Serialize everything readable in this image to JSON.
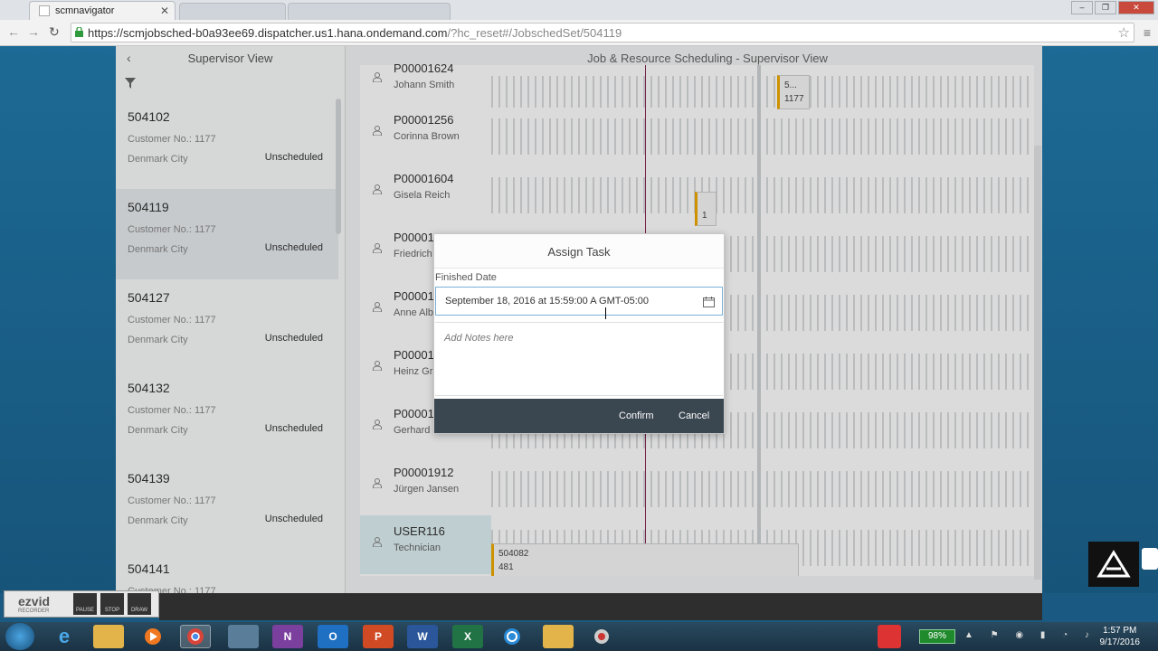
{
  "browser": {
    "tab_title": "scmnavigator",
    "url_host": "https://scmjobsched-b0a93ee69.dispatcher.us1.hana.ondemand.com",
    "url_path": "/?hc_reset#/JobschedSet/504119"
  },
  "master": {
    "title": "Supervisor View",
    "items": [
      {
        "id": "504102",
        "customer": "Customer No.: 1177",
        "city": "Denmark City",
        "status": "Unscheduled"
      },
      {
        "id": "504119",
        "customer": "Customer No.: 1177",
        "city": "Denmark City",
        "status": "Unscheduled"
      },
      {
        "id": "504127",
        "customer": "Customer No.: 1177",
        "city": "Denmark City",
        "status": "Unscheduled"
      },
      {
        "id": "504132",
        "customer": "Customer No.: 1177",
        "city": "Denmark City",
        "status": "Unscheduled"
      },
      {
        "id": "504139",
        "customer": "Customer No.: 1177",
        "city": "Denmark City",
        "status": "Unscheduled"
      },
      {
        "id": "504141",
        "customer": "Customer No.: 1177",
        "city": "",
        "status": ""
      }
    ]
  },
  "detail": {
    "title": "Job & Resource Scheduling - Supervisor View",
    "resources": [
      {
        "id": "P00001624",
        "name": "Johann Smith"
      },
      {
        "id": "P00001256",
        "name": "Corinna Brown"
      },
      {
        "id": "P00001604",
        "name": "Gisela Reich"
      },
      {
        "id": "P00001",
        "name": "Friedrich"
      },
      {
        "id": "P00001",
        "name": "Anne Alb"
      },
      {
        "id": "P00001",
        "name": "Heinz Gr"
      },
      {
        "id": "P00001",
        "name": "Gerhard Keller"
      },
      {
        "id": "P00001912",
        "name": "Jürgen Jansen"
      },
      {
        "id": "USER116",
        "name": "Technician"
      }
    ],
    "tasks": {
      "t1_line1": "5...",
      "t1_line2": "1177",
      "t2_line1": "1",
      "t3_line1": "504082",
      "t3_line2": "481"
    }
  },
  "dialog": {
    "title": "Assign Task",
    "finished_date_label": "Finished Date",
    "finished_date_value": "September 18, 2016 at 15:59:00 A GMT-05:00",
    "notes_placeholder": "Add Notes here",
    "confirm_label": "Confirm",
    "cancel_label": "Cancel"
  },
  "ezvid": {
    "logo": "ezvid",
    "sub": "RECORDER",
    "pause": "PAUSE",
    "stop": "STOP",
    "draw": "DRAW"
  },
  "taskbar": {
    "battery": "98%",
    "time": "1:57 PM",
    "date": "9/17/2016",
    "word_letter": "W",
    "excel_letter": "X",
    "onenote_letter": "N",
    "ppt_letter": "P",
    "outlook_letter": "O"
  }
}
